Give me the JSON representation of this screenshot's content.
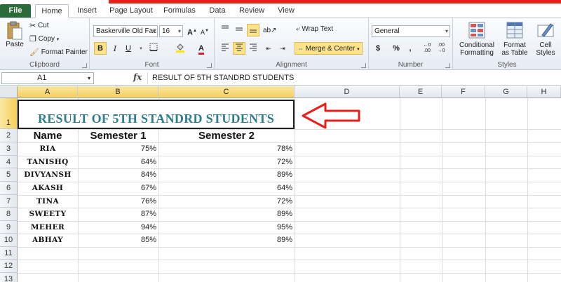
{
  "tabs": {
    "file": "File",
    "home": "Home",
    "insert": "Insert",
    "page_layout": "Page Layout",
    "formulas": "Formulas",
    "data": "Data",
    "review": "Review",
    "view": "View"
  },
  "ribbon": {
    "clipboard": {
      "label": "Clipboard",
      "paste": "Paste",
      "cut": "Cut",
      "copy": "Copy",
      "format_painter": "Format Painter"
    },
    "font": {
      "label": "Font",
      "font_name": "Baskerville Old Fac",
      "font_size": "16",
      "bold": "B",
      "italic": "I",
      "underline": "U"
    },
    "alignment": {
      "label": "Alignment",
      "wrap_text": "Wrap Text",
      "merge_center": "Merge & Center"
    },
    "number": {
      "label": "Number",
      "format": "General",
      "currency": "$",
      "percent": "%",
      "comma": ","
    },
    "styles": {
      "label": "Styles",
      "conditional_l1": "Conditional",
      "conditional_l2": "Formatting",
      "format_table_l1": "Format",
      "format_table_l2": "as Table",
      "cell_styles_l1": "Cell",
      "cell_styles_l2": "Styles"
    }
  },
  "formula_bar": {
    "name_box": "A1",
    "fx": "fx",
    "content": "RESULT OF 5TH STANDRD STUDENTS"
  },
  "sheet": {
    "columns": [
      "A",
      "B",
      "C",
      "D",
      "E",
      "F",
      "G",
      "H"
    ],
    "rows": [
      "1",
      "2",
      "3",
      "4",
      "5",
      "6",
      "7",
      "8",
      "9",
      "10",
      "11",
      "12",
      "13"
    ],
    "title": "RESULT OF 5TH STANDRD STUDENTS",
    "headers": [
      "Name",
      "Semester 1",
      "Semester 2"
    ],
    "records": [
      {
        "name": "RIA",
        "s1": "75%",
        "s2": "78%"
      },
      {
        "name": "TANISHQ",
        "s1": "64%",
        "s2": "72%"
      },
      {
        "name": "DIVYANSH",
        "s1": "84%",
        "s2": "89%"
      },
      {
        "name": "AKASH",
        "s1": "67%",
        "s2": "64%"
      },
      {
        "name": "TINA",
        "s1": "76%",
        "s2": "72%"
      },
      {
        "name": "SWEETY",
        "s1": "87%",
        "s2": "89%"
      },
      {
        "name": "MEHER",
        "s1": "94%",
        "s2": "95%"
      },
      {
        "name": "ABHAY",
        "s1": "85%",
        "s2": "89%"
      }
    ]
  },
  "colors": {
    "file_tab": "#2a6b3a",
    "title_text": "#2e7d8f",
    "arrow": "#e8201c",
    "selected_header": "#f6cf5b"
  }
}
